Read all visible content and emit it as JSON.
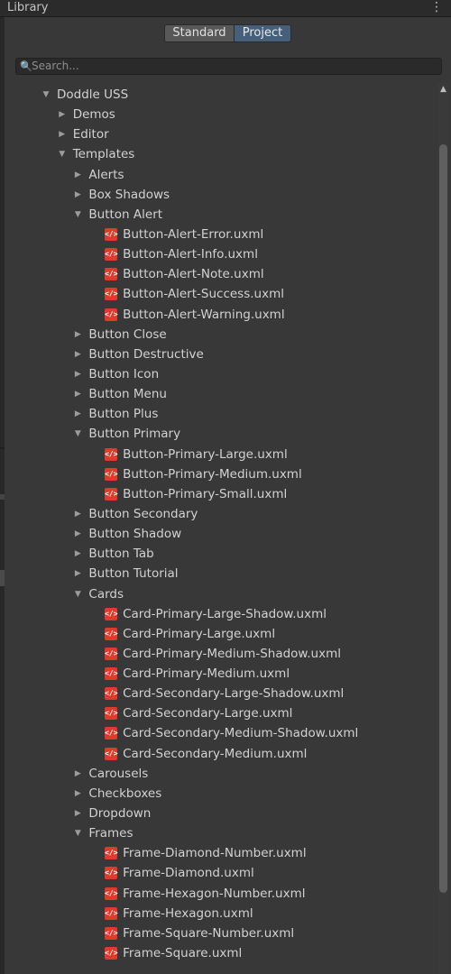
{
  "window": {
    "title": "Library",
    "menu_icon": "more-vert-icon"
  },
  "toggle": {
    "standard_label": "Standard",
    "project_label": "Project",
    "selected": "Project"
  },
  "search": {
    "placeholder": "Search..."
  },
  "tree": [
    {
      "label": "Doddle USS",
      "depth": 0,
      "type": "folder",
      "expanded": true
    },
    {
      "label": "Demos",
      "depth": 1,
      "type": "folder",
      "expanded": false
    },
    {
      "label": "Editor",
      "depth": 1,
      "type": "folder",
      "expanded": false
    },
    {
      "label": "Templates",
      "depth": 1,
      "type": "folder",
      "expanded": true
    },
    {
      "label": "Alerts",
      "depth": 2,
      "type": "folder",
      "expanded": false
    },
    {
      "label": "Box Shadows",
      "depth": 2,
      "type": "folder",
      "expanded": false
    },
    {
      "label": "Button Alert",
      "depth": 2,
      "type": "folder",
      "expanded": true
    },
    {
      "label": "Button-Alert-Error.uxml",
      "depth": 3,
      "type": "file"
    },
    {
      "label": "Button-Alert-Info.uxml",
      "depth": 3,
      "type": "file"
    },
    {
      "label": "Button-Alert-Note.uxml",
      "depth": 3,
      "type": "file"
    },
    {
      "label": "Button-Alert-Success.uxml",
      "depth": 3,
      "type": "file"
    },
    {
      "label": "Button-Alert-Warning.uxml",
      "depth": 3,
      "type": "file"
    },
    {
      "label": "Button Close",
      "depth": 2,
      "type": "folder",
      "expanded": false
    },
    {
      "label": "Button Destructive",
      "depth": 2,
      "type": "folder",
      "expanded": false
    },
    {
      "label": "Button Icon",
      "depth": 2,
      "type": "folder",
      "expanded": false
    },
    {
      "label": "Button Menu",
      "depth": 2,
      "type": "folder",
      "expanded": false
    },
    {
      "label": "Button Plus",
      "depth": 2,
      "type": "folder",
      "expanded": false
    },
    {
      "label": "Button Primary",
      "depth": 2,
      "type": "folder",
      "expanded": true
    },
    {
      "label": "Button-Primary-Large.uxml",
      "depth": 3,
      "type": "file"
    },
    {
      "label": "Button-Primary-Medium.uxml",
      "depth": 3,
      "type": "file"
    },
    {
      "label": "Button-Primary-Small.uxml",
      "depth": 3,
      "type": "file"
    },
    {
      "label": "Button Secondary",
      "depth": 2,
      "type": "folder",
      "expanded": false
    },
    {
      "label": "Button Shadow",
      "depth": 2,
      "type": "folder",
      "expanded": false
    },
    {
      "label": "Button Tab",
      "depth": 2,
      "type": "folder",
      "expanded": false
    },
    {
      "label": "Button Tutorial",
      "depth": 2,
      "type": "folder",
      "expanded": false
    },
    {
      "label": "Cards",
      "depth": 2,
      "type": "folder",
      "expanded": true
    },
    {
      "label": "Card-Primary-Large-Shadow.uxml",
      "depth": 3,
      "type": "file"
    },
    {
      "label": "Card-Primary-Large.uxml",
      "depth": 3,
      "type": "file"
    },
    {
      "label": "Card-Primary-Medium-Shadow.uxml",
      "depth": 3,
      "type": "file"
    },
    {
      "label": "Card-Primary-Medium.uxml",
      "depth": 3,
      "type": "file"
    },
    {
      "label": "Card-Secondary-Large-Shadow.uxml",
      "depth": 3,
      "type": "file"
    },
    {
      "label": "Card-Secondary-Large.uxml",
      "depth": 3,
      "type": "file"
    },
    {
      "label": "Card-Secondary-Medium-Shadow.uxml",
      "depth": 3,
      "type": "file"
    },
    {
      "label": "Card-Secondary-Medium.uxml",
      "depth": 3,
      "type": "file"
    },
    {
      "label": "Carousels",
      "depth": 2,
      "type": "folder",
      "expanded": false
    },
    {
      "label": "Checkboxes",
      "depth": 2,
      "type": "folder",
      "expanded": false
    },
    {
      "label": "Dropdown",
      "depth": 2,
      "type": "folder",
      "expanded": false
    },
    {
      "label": "Frames",
      "depth": 2,
      "type": "folder",
      "expanded": true
    },
    {
      "label": "Frame-Diamond-Number.uxml",
      "depth": 3,
      "type": "file"
    },
    {
      "label": "Frame-Diamond.uxml",
      "depth": 3,
      "type": "file"
    },
    {
      "label": "Frame-Hexagon-Number.uxml",
      "depth": 3,
      "type": "file"
    },
    {
      "label": "Frame-Hexagon.uxml",
      "depth": 3,
      "type": "file"
    },
    {
      "label": "Frame-Square-Number.uxml",
      "depth": 3,
      "type": "file"
    },
    {
      "label": "Frame-Square.uxml",
      "depth": 3,
      "type": "file"
    }
  ],
  "colors": {
    "background": "#383838",
    "selected_toggle": "#46607c",
    "uxml_icon": "#e03a2c"
  }
}
